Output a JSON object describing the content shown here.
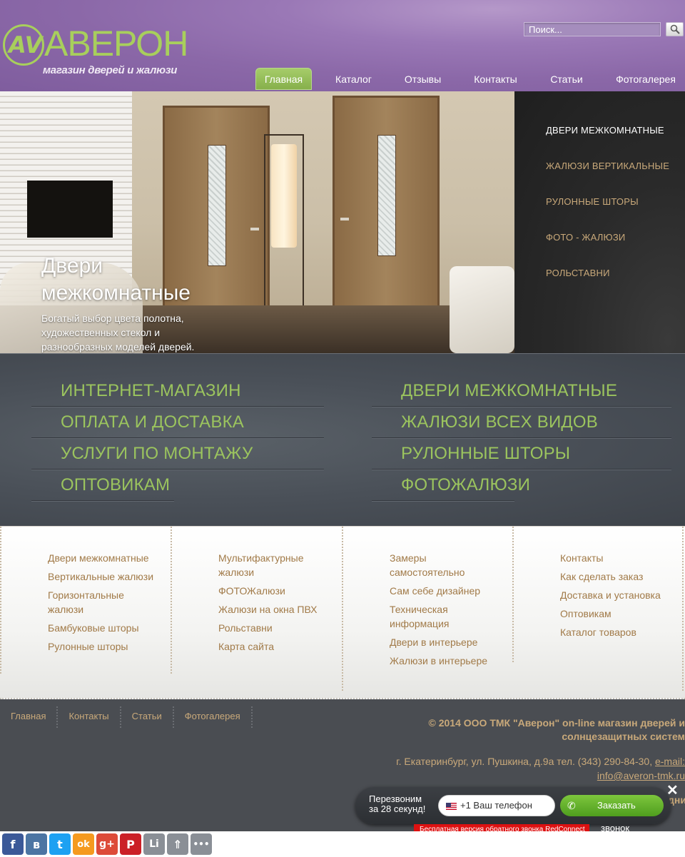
{
  "header": {
    "logo_mark": "AV",
    "logo_name": "АВЕРОН",
    "logo_sub": "магазин дверей и жалюзи",
    "search_placeholder": "Поиск...",
    "search_icon": "magnifier-icon"
  },
  "nav": [
    "Главная",
    "Каталог",
    "Отзывы",
    "Контакты",
    "Статьи",
    "Фотогалерея"
  ],
  "slider": {
    "title": "Двери межкомнатные",
    "description": "Богатый выбор цвета полотна, художественных стекол и разнообразных моделей дверей.",
    "menu": [
      "ДВЕРИ МЕЖКОМНАТНЫЕ",
      "ЖАЛЮЗИ ВЕРТИКАЛЬНЫЕ",
      "РУЛОННЫЕ ШТОРЫ",
      "ФОТО - ЖАЛЮЗИ",
      "РОЛЬСТАВНИ"
    ]
  },
  "band": {
    "left": [
      "ИНТЕРНЕТ-МАГАЗИН",
      "ОПЛАТА И ДОСТАВКА",
      "УСЛУГИ ПО МОНТАЖУ",
      "ОПТОВИКАМ"
    ],
    "right": [
      "ДВЕРИ МЕЖКОМНАТНЫЕ",
      "ЖАЛЮЗИ ВСЕХ ВИДОВ",
      "РУЛОННЫЕ ШТОРЫ",
      "ФОТОЖАЛЮЗИ"
    ]
  },
  "link_columns": [
    [
      "Двери межкомнатные",
      "Вертикальные жалюзи",
      "Горизонтальные жалюзи",
      "Бамбуковые шторы",
      "Рулонные шторы"
    ],
    [
      "Мультифактурные жалюзи",
      "ФОТОЖалюзи",
      "Жалюзи на окна ПВХ",
      "Рольставни",
      "Карта сайта"
    ],
    [
      "Замеры самостоятельно",
      "Сам себе дизайнер",
      "Техническая информация",
      "Двери в интерьере",
      "Жалюзи в интерьере"
    ],
    [
      "Контакты",
      "Как сделать заказ",
      "Доставка и установка",
      "Оптовикам",
      "Каталог товаров"
    ]
  ],
  "footer": {
    "nav": [
      "Главная",
      "Контакты",
      "Статьи",
      "Фотогалерея"
    ],
    "copyright_line1": "© 2014 ООО ТМК \"Аверон\" on-line магазин дверей и",
    "copyright_line2": "солнцезащитных систем",
    "address": "г. Екатеринбург, ул. Пушкина, д.9а тел. (343) 290-84-30,",
    "email_label": "e-mail:",
    "email": "info@averon-tmk.ru",
    "cut_text": "дни"
  },
  "callback": {
    "text_line1": "Перезвоним",
    "text_line2": "за 28 секунд!",
    "phone_placeholder": "+1 Ваш телефон",
    "button": "Заказать",
    "button_tail": "звонок",
    "free_note": "Бесплатная версия обратного звонка RedConnect",
    "close": "✕"
  },
  "share": [
    {
      "icon": "facebook-icon",
      "glyph": "f",
      "color": "#3b5998"
    },
    {
      "icon": "vk-icon",
      "glyph": "в",
      "color": "#4c75a3"
    },
    {
      "icon": "twitter-icon",
      "glyph": "t",
      "color": "#1da1f2"
    },
    {
      "icon": "odnoklassniki-icon",
      "glyph": "ok",
      "color": "#f59a1f"
    },
    {
      "icon": "google-plus-icon",
      "glyph": "g+",
      "color": "#dd4b39"
    },
    {
      "icon": "pinterest-icon",
      "glyph": "P",
      "color": "#cb2027"
    },
    {
      "icon": "liveinternet-icon",
      "glyph": "Li",
      "color": "#8a8f96"
    },
    {
      "icon": "up-arrows-icon",
      "glyph": "⇑",
      "color": "#8a8f96"
    },
    {
      "icon": "more-icon",
      "glyph": "•••",
      "color": "#8a8f96"
    }
  ]
}
